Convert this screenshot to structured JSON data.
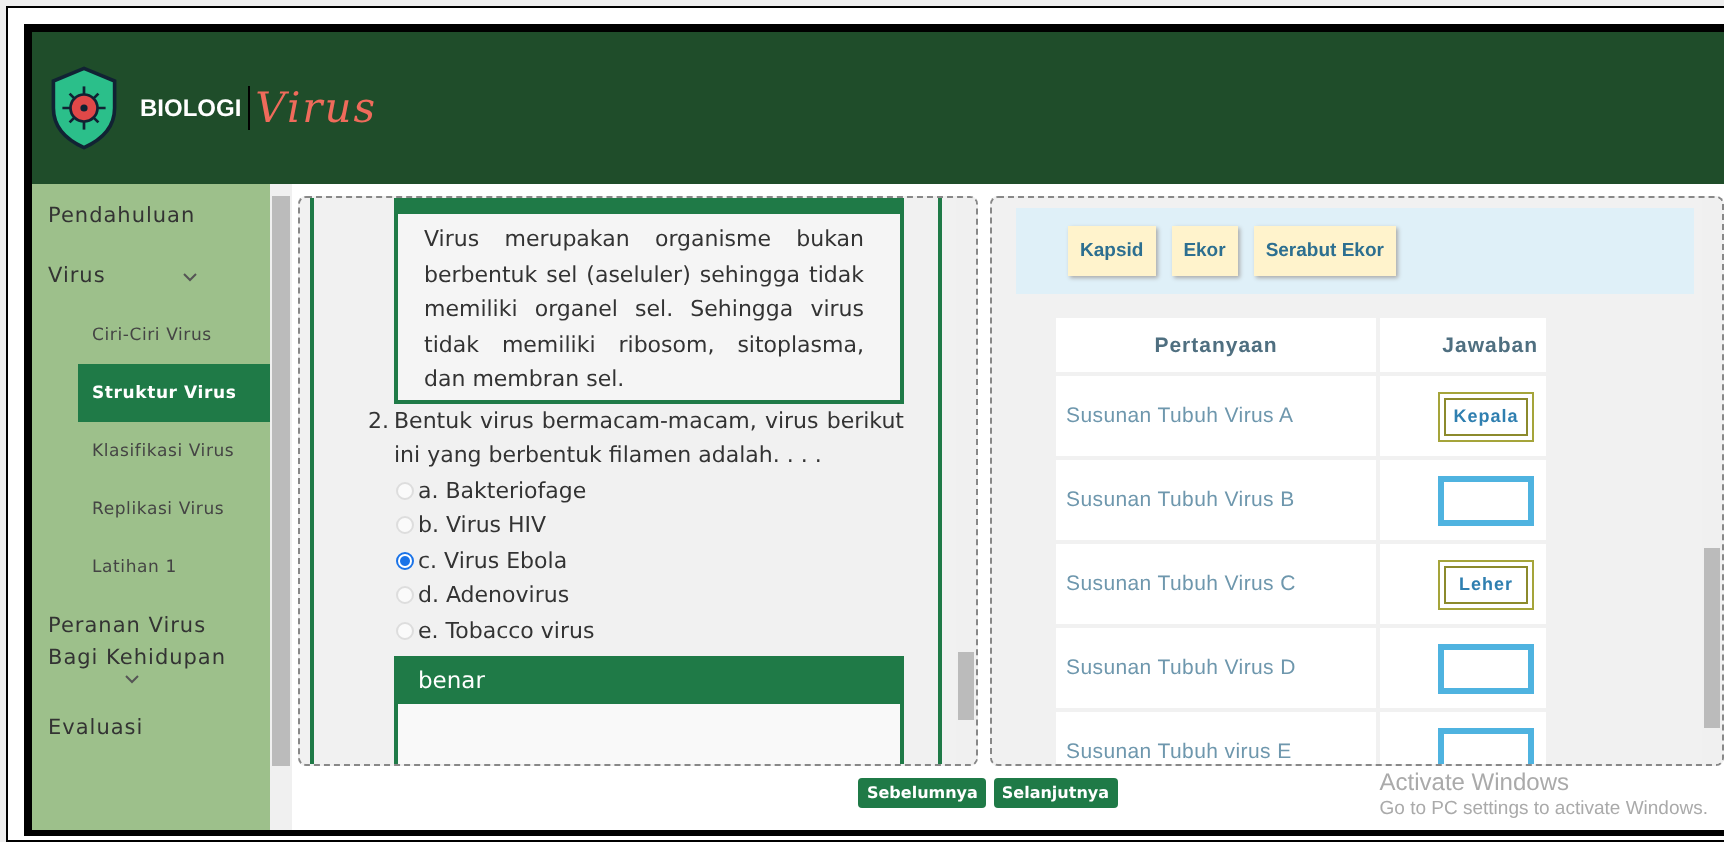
{
  "header": {
    "brand": "BIOLOGI",
    "title": "Virus"
  },
  "sidebar": {
    "items": [
      {
        "label": "Pendahuluan",
        "kind": "link",
        "selected": false
      },
      {
        "label": "Virus",
        "kind": "group",
        "selected": false,
        "children": [
          {
            "label": "Ciri-Ciri Virus",
            "selected": false
          },
          {
            "label": "Struktur Virus",
            "selected": true
          },
          {
            "label": "Klasifikasi Virus",
            "selected": false
          },
          {
            "label": "Replikasi Virus",
            "selected": false
          },
          {
            "label": "Latihan 1",
            "selected": false
          }
        ]
      },
      {
        "label": "Peranan Virus Bagi Kehidupan",
        "kind": "group",
        "selected": false
      },
      {
        "label": "Evaluasi",
        "kind": "link",
        "selected": false
      }
    ]
  },
  "quiz": {
    "explanation": "Virus merupakan organisme bukan berbentuk sel (aseluler) sehingga tidak memiliki organel sel. Sehingga virus tidak memiliki ribosom, sitoplasma, dan membran sel.",
    "question_number": "2.",
    "question": "Bentuk virus bermacam-macam, virus berikut ini yang berbentuk filamen adalah. . . .",
    "options": [
      {
        "label": "a. Bakteriofage",
        "selected": false
      },
      {
        "label": "b. Virus HIV",
        "selected": false
      },
      {
        "label": "c. Virus Ebola",
        "selected": true
      },
      {
        "label": "d. Adenovirus",
        "selected": false
      },
      {
        "label": "e. Tobacco virus",
        "selected": false
      }
    ],
    "feedback": "benar"
  },
  "matching": {
    "tiles": [
      "Kapsid",
      "Ekor",
      "Serabut Ekor"
    ],
    "columns": [
      "Pertanyaan",
      "Jawaban"
    ],
    "rows": [
      {
        "question": "Susunan Tubuh Virus A",
        "filled": true,
        "answer": "Kepala"
      },
      {
        "question": "Susunan Tubuh Virus B",
        "filled": false
      },
      {
        "question": "Susunan Tubuh Virus C",
        "filled": true,
        "answer": "Leher"
      },
      {
        "question": "Susunan Tubuh Virus D",
        "filled": false
      },
      {
        "question": "Susunan Tubuh virus E",
        "filled": false
      }
    ]
  },
  "buttons": [
    "Sebelumnya",
    "Selanjutnya"
  ],
  "system_notice": {
    "title": "Activate Windows",
    "text": "Go to PC settings to activate Windows."
  }
}
